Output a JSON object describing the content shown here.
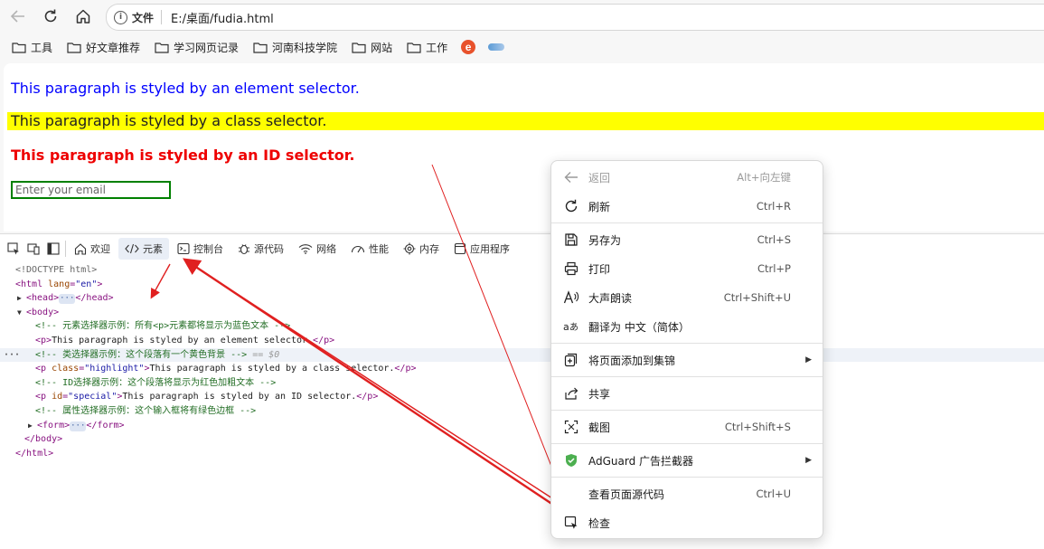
{
  "browser": {
    "file_chip": "文件",
    "url": "E:/桌面/fudia.html"
  },
  "bookmarks": [
    {
      "label": "工具"
    },
    {
      "label": "好文章推荐"
    },
    {
      "label": "学习网页记录"
    },
    {
      "label": "河南科技学院"
    },
    {
      "label": "网站"
    },
    {
      "label": "工作"
    }
  ],
  "page": {
    "p_element": "This paragraph is styled by an element selector.",
    "p_class": "This paragraph is styled by a class selector.",
    "p_id": "This paragraph is styled by an ID selector.",
    "email_placeholder": "Enter your email",
    "colors": {
      "element_text": "#0000ff",
      "class_bg": "#ffff00",
      "id_text": "#ee0000",
      "input_border": "#008000"
    }
  },
  "devtools": {
    "tabs": [
      {
        "label": "欢迎",
        "icon": "home-icon"
      },
      {
        "label": "元素",
        "icon": "code-icon",
        "active": true
      },
      {
        "label": "控制台",
        "icon": "console-icon"
      },
      {
        "label": "源代码",
        "icon": "bug-icon"
      },
      {
        "label": "网络",
        "icon": "wifi-icon"
      },
      {
        "label": "性能",
        "icon": "gauge-icon"
      },
      {
        "label": "内存",
        "icon": "gear-icon"
      },
      {
        "label": "应用程序",
        "icon": "app-icon"
      }
    ],
    "code": {
      "doctype": "<!DOCTYPE html>",
      "html_open": "<html",
      "lang_attr": "lang",
      "lang_val": "\"en\"",
      "head_open": "<head>",
      "head_close": "</head>",
      "body_open": "<body>",
      "c1": "<!-- 元素选择器示例：所有<p>元素都将显示为蓝色文本 -->",
      "p1_open": "<p>",
      "p1_text": "This paragraph is styled by an element selector.",
      "p1_close": "</p>",
      "c2": "<!-- 类选择器示例：这个段落有一个黄色背景 -->",
      "c2_eq": "== $0",
      "p2_open": "<p",
      "p2_attr": "class",
      "p2_val": "\"highlight\"",
      "p2_text": "This paragraph is styled by a class selector.",
      "p2_close": "</p>",
      "c3": "<!-- ID选择器示例：这个段落将显示为红色加粗文本 -->",
      "p3_open": "<p",
      "p3_attr": "id",
      "p3_val": "\"special\"",
      "p3_text": "This paragraph is styled by an ID selector.",
      "p3_close": "</p>",
      "c4": "<!-- 属性选择器示例：这个输入框将有绿色边框 -->",
      "form_open": "<form>",
      "form_close": "</form>",
      "body_close": "</body>",
      "html_close": "</html>"
    }
  },
  "context_menu": {
    "back": {
      "label": "返回",
      "key": "Alt+向左键"
    },
    "refresh": {
      "label": "刷新",
      "key": "Ctrl+R"
    },
    "save_as": {
      "label": "另存为",
      "key": "Ctrl+S"
    },
    "print": {
      "label": "打印",
      "key": "Ctrl+P"
    },
    "read_aloud": {
      "label": "大声朗读",
      "key": "Ctrl+Shift+U"
    },
    "translate": {
      "label": "翻译为 中文（简体）"
    },
    "add_collection": {
      "label": "将页面添加到集锦"
    },
    "share": {
      "label": "共享"
    },
    "screenshot": {
      "label": "截图",
      "key": "Ctrl+Shift+S"
    },
    "adguard": {
      "label": "AdGuard 广告拦截器"
    },
    "view_source": {
      "label": "查看页面源代码",
      "key": "Ctrl+U"
    },
    "inspect": {
      "label": "检查"
    }
  },
  "annotation_color": "#e02020"
}
